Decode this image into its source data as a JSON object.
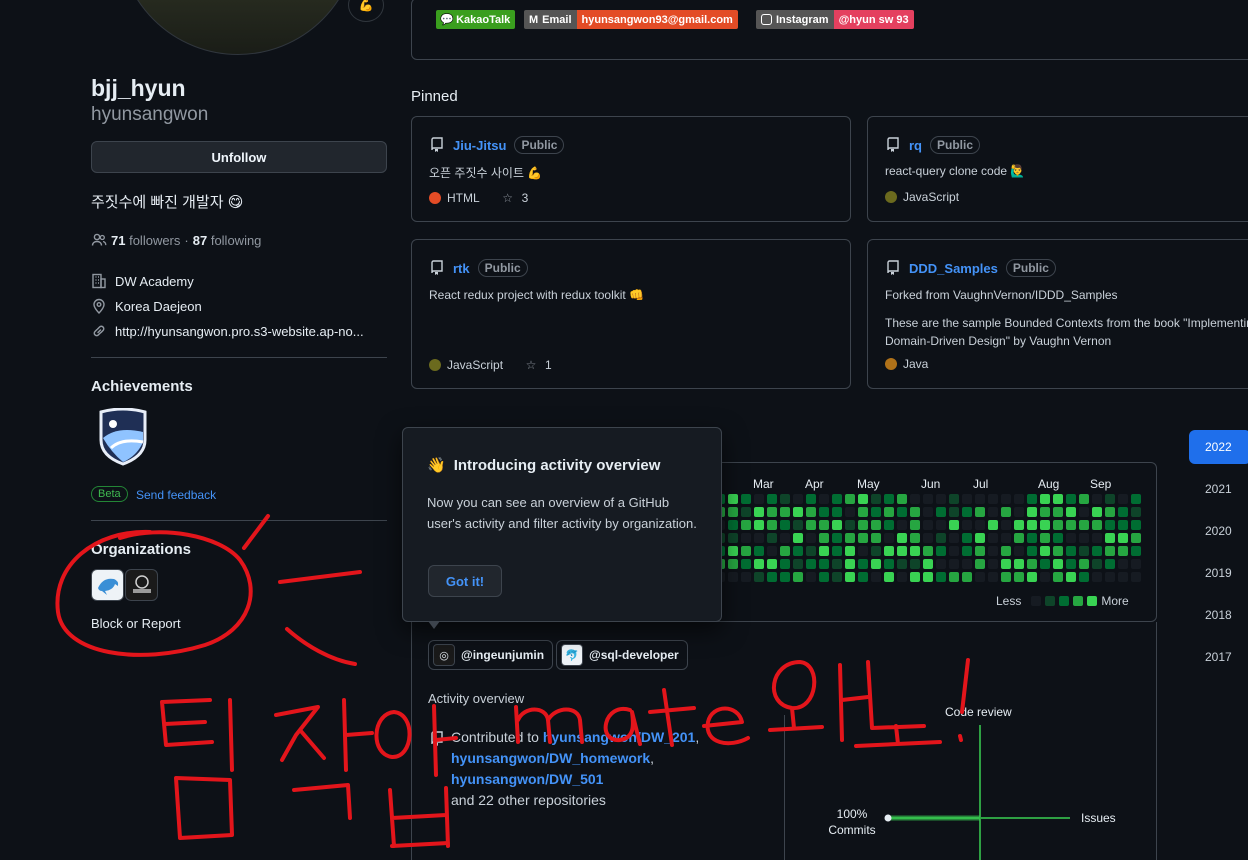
{
  "profile": {
    "display_name": "bjj_hyun",
    "login": "hyunsangwon",
    "status_emoji": "💪",
    "follow_button": "Unfollow",
    "bio": "주짓수에 빠진 개발자 😋",
    "followers_count": "71",
    "followers_label": "followers",
    "separator": "·",
    "following_count": "87",
    "following_label": "following",
    "company": "DW Academy",
    "location": "Korea Daejeon",
    "website": "http://hyunsangwon.pro.s3-website.ap-no..."
  },
  "achievements": {
    "heading": "Achievements",
    "beta_label": "Beta",
    "feedback_label": "Send feedback"
  },
  "organizations": {
    "heading": "Organizations",
    "block_label": "Block or Report"
  },
  "readme_badges": [
    {
      "icon": "kakaotalk-icon",
      "label": "KakaoTalk",
      "color": "#3a9e1e"
    },
    {
      "icon": "gmail-icon",
      "label": "Email",
      "value": "hyunsangwon93@gmail.com",
      "label_color": "#555555",
      "value_color": "#e34c26"
    },
    {
      "icon": "instagram-icon",
      "label": "Instagram",
      "value": "@hyun sw 93",
      "label_color": "#555555",
      "value_color": "#e4405f"
    }
  ],
  "pinned": {
    "heading": "Pinned",
    "repos": [
      {
        "name": "Jiu-Jitsu",
        "visibility": "Public",
        "description": "오픈 주짓수 사이트 💪",
        "language": "HTML",
        "language_color": "#e34c26",
        "stars": "3"
      },
      {
        "name": "rq",
        "visibility": "Public",
        "description": "react-query clone code 🙋‍♂️",
        "language": "JavaScript",
        "language_color": "#f1e05a"
      },
      {
        "name": "rtk",
        "visibility": "Public",
        "description": "React redux project with redux toolkit 👊",
        "language": "JavaScript",
        "language_color": "#f1e05a",
        "stars": "1"
      },
      {
        "name": "DDD_Samples",
        "visibility": "Public",
        "forked_from": "Forked from VaughnVernon/IDDD_Samples",
        "description": "These are the sample Bounded Contexts from the book \"Implementing Domain-Driven Design\" by Vaughn Vernon",
        "language": "Java",
        "language_color": "#b07219"
      }
    ]
  },
  "contributions": {
    "months": [
      "Mar",
      "Apr",
      "May",
      "Jun",
      "Jul",
      "Aug",
      "Sep"
    ],
    "legend_less": "Less",
    "legend_more": "More",
    "years": [
      "2022",
      "2021",
      "2020",
      "2019",
      "2018",
      "2017"
    ],
    "selected_year": "2022",
    "colors": [
      "#161b22",
      "#0e4429",
      "#006d32",
      "#26a641",
      "#39d353"
    ]
  },
  "popover": {
    "emoji": "👋",
    "title": "Introducing activity overview",
    "body": "Now you can see an overview of a GitHub user's activity and filter activity by organization.",
    "button": "Got it!"
  },
  "activity": {
    "orgs": [
      "@ingeunjumin",
      "@sql-developer"
    ],
    "heading": "Activity overview",
    "contributed_prefix": "Contributed to",
    "repo1": "hyunsangwon/DW_201",
    "repo2": "hyunsangwon/DW_homework",
    "repo3": "hyunsangwon/DW_501",
    "others": "and 22 other repositories",
    "axis_top": "Code review",
    "axis_right": "Issues",
    "axis_left_pct": "100%",
    "axis_left": "Commits"
  },
  "annotation": {
    "handwritten_text": "팀 작업 mate 와 노!",
    "ink_color": "#e3151b"
  }
}
